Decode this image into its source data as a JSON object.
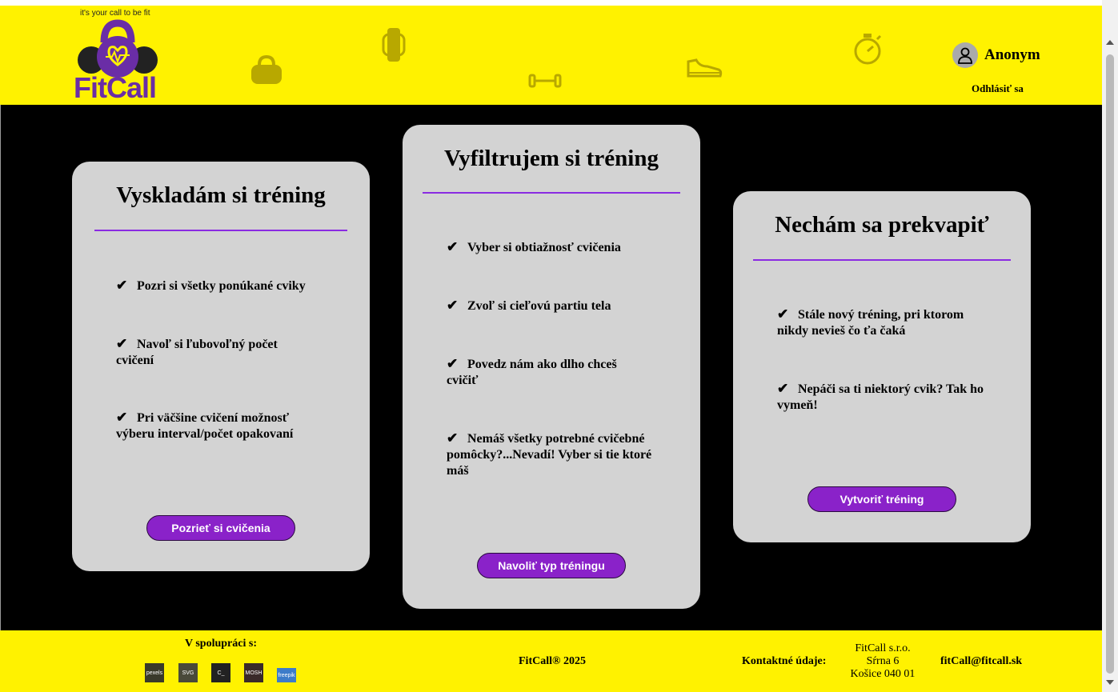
{
  "header": {
    "tagline": "it's your call to be fit",
    "logo_text": "FitCall",
    "user_name": "Anonym",
    "logout_label": "Odhlásiť sa"
  },
  "cards": [
    {
      "title": "Vyskladám si tréning",
      "items": [
        "Pozri si všetky ponúkané cviky",
        "Navoľ si ľubovoľný počet cvičení",
        "Pri väčšine cvičení možnosť výberu interval/počet opakovaní"
      ],
      "button": "Pozrieť si cvičenia"
    },
    {
      "title": "Vyfiltrujem si tréning",
      "items": [
        "Vyber si obtiažnosť cvičenia",
        "Zvoľ si cieľovú partiu tela",
        "Povedz nám ako dlho chceš cvičiť",
        "Nemáš všetky potrebné cvičebné pomôcky?...Nevadí! Vyber si tie ktoré máš"
      ],
      "button": "Navoliť typ tréningu"
    },
    {
      "title": "Nechám sa prekvapiť",
      "items": [
        "Stále nový tréning, pri ktorom nikdy nevieš čo ťa čaká",
        "Nepáči sa ti niektorý cvik? Tak ho vymeň!"
      ],
      "button": "Vytvoriť tréning"
    }
  ],
  "check_glyph": "✔",
  "footer": {
    "cooperation_label": "V spolupráci s:",
    "partners": [
      "pexels",
      "SVG",
      "C_",
      "MOSH",
      "freepik"
    ],
    "copyright": "FitCall® 2025",
    "contact_label": "Kontaktné údaje:",
    "address": [
      "FitCall s.r.o.",
      "Sŕrna 6",
      "Košice 040 01"
    ],
    "email": "fitCall@fitcall.sk"
  },
  "colors": {
    "header_bg": "#fff200",
    "accent_purple": "#8a22c9",
    "card_bg": "#d3d3d3",
    "main_bg": "#000000"
  }
}
